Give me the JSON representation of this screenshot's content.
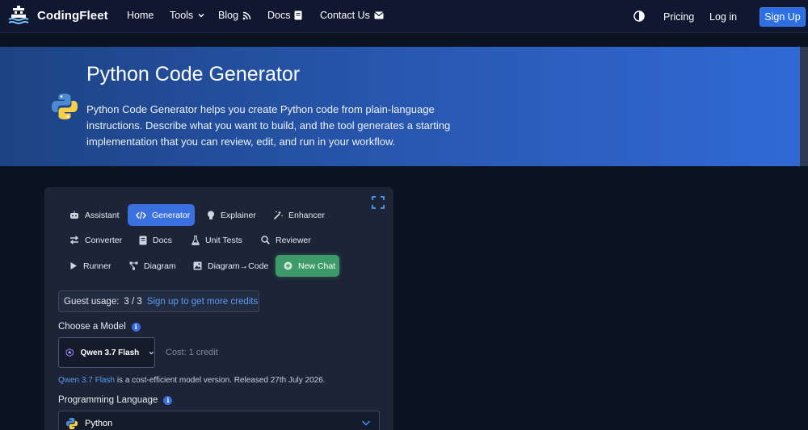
{
  "brand": {
    "name": "CodingFleet"
  },
  "nav": {
    "home": "Home",
    "tools": "Tools",
    "blog": "Blog",
    "docs": "Docs",
    "contact": "Contact Us",
    "pricing": "Pricing",
    "login": "Log in",
    "signup": "Sign Up"
  },
  "hero": {
    "title": "Python Code Generator",
    "description": "Python Code Generator helps you create Python code from plain-language instructions. Describe what you want to build, and the tool generates a starting implementation that you can review, edit, and run in your workflow."
  },
  "tabs": [
    {
      "label": "Assistant",
      "icon": "robot-icon"
    },
    {
      "label": "Generator",
      "icon": "code-icon",
      "active": true
    },
    {
      "label": "Explainer",
      "icon": "lightbulb-icon"
    },
    {
      "label": "Enhancer",
      "icon": "magic-wand-icon"
    },
    {
      "label": "Converter",
      "icon": "swap-icon"
    },
    {
      "label": "Docs",
      "icon": "book-icon"
    },
    {
      "label": "Unit Tests",
      "icon": "flask-icon"
    },
    {
      "label": "Reviewer",
      "icon": "magnifier-icon"
    },
    {
      "label": "Runner",
      "icon": "play-icon"
    },
    {
      "label": "Diagram",
      "icon": "diagram-icon"
    },
    {
      "label": "Diagram→Code",
      "icon": "image-icon"
    },
    {
      "label": "New Chat",
      "icon": "plus-circle-icon"
    }
  ],
  "usage": {
    "label": "Guest usage:",
    "count": "3 / 3",
    "link": "Sign up to get more credits"
  },
  "model": {
    "label": "Choose a Model",
    "selected": "Qwen 3.7 Flash",
    "cost": "Cost: 1 credit",
    "note_link": "Qwen 3.7 Flash",
    "note_text": " is a cost-efficient model version. Released 27th July 2026."
  },
  "language": {
    "label": "Programming Language",
    "selected": "Python"
  },
  "colors": {
    "accent": "#3a6fe0",
    "success": "#3f9a6a",
    "link": "#5b9bf5"
  }
}
